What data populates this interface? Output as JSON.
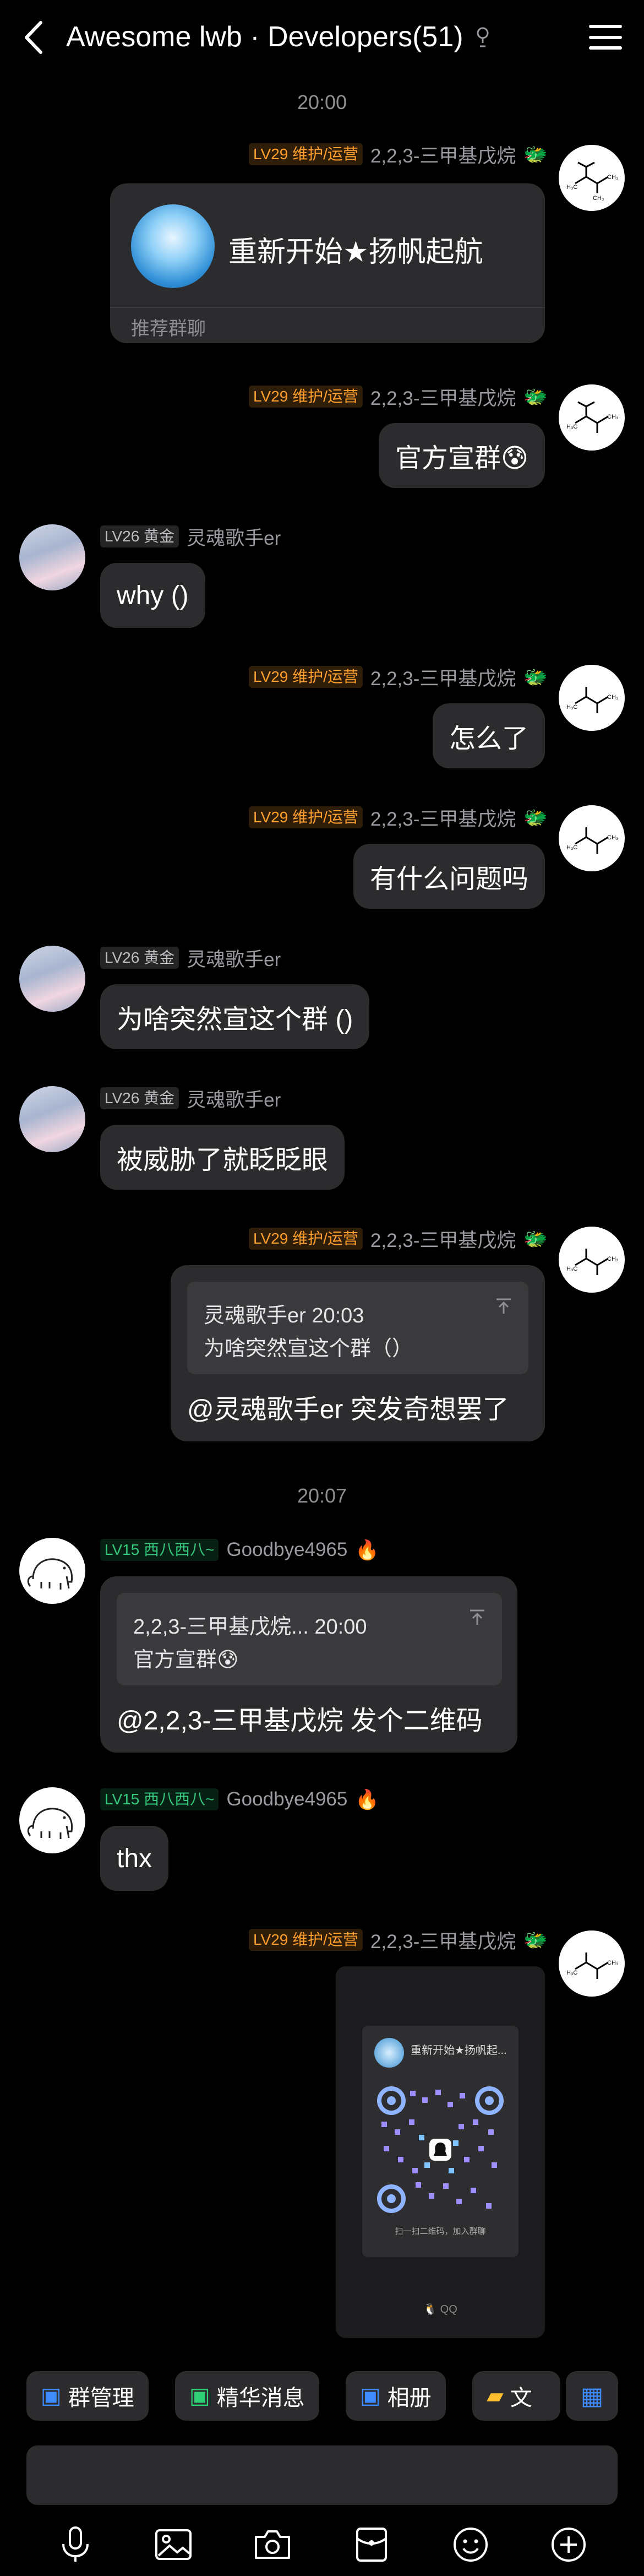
{
  "header": {
    "title": "Awesome lwb · Developers(51)",
    "back_icon": "chevron-left-icon",
    "robot_icon": "robot-icon",
    "menu_icon": "hamburger-menu-icon"
  },
  "timestamps": [
    "20:00",
    "20:07"
  ],
  "messages": [
    {
      "sender": "2,2,3-三甲基戊烷",
      "badge": "LV29 维护/运营",
      "type": "group-card",
      "card_title": "重新开始★扬帆起航",
      "card_footer": "推荐群聊"
    },
    {
      "sender": "2,2,3-三甲基戊烷",
      "badge": "LV29 维护/运营",
      "text": "官方宣群😰"
    },
    {
      "sender": "灵魂歌手er",
      "badge": "LV26 黄金",
      "text": "why ()"
    },
    {
      "sender": "2,2,3-三甲基戊烷",
      "badge": "LV29 维护/运营",
      "text": "怎么了"
    },
    {
      "sender": "2,2,3-三甲基戊烷",
      "badge": "LV29 维护/运营",
      "text": "有什么问题吗"
    },
    {
      "sender": "灵魂歌手er",
      "badge": "LV26 黄金",
      "text": "为啥突然宣这个群 ()"
    },
    {
      "sender": "灵魂歌手er",
      "badge": "LV26 黄金",
      "text": "被威胁了就眨眨眼"
    },
    {
      "sender": "2,2,3-三甲基戊烷",
      "badge": "LV29 维护/运营",
      "quote_header": "灵魂歌手er 20:03",
      "quote_text": "为啥突然宣这个群（）",
      "text": "@灵魂歌手er 突发奇想罢了"
    },
    {
      "sender": "Goodbye4965",
      "badge": "LV15 西八西八~",
      "quote_header": "2,2,3-三甲基戊烷... 20:00",
      "quote_text": "官方宣群😰",
      "text": "@2,2,3-三甲基戊烷 发个二维码"
    },
    {
      "sender": "Goodbye4965",
      "badge": "LV15 西八西八~",
      "text": "thx"
    },
    {
      "sender": "2,2,3-三甲基戊烷",
      "badge": "LV29 维护/运营",
      "type": "image",
      "image_title": "重新开始★扬帆起...",
      "image_caption": "扫一扫二维码，加入群聊",
      "image_logo": "QQ"
    }
  ],
  "toolbar": {
    "chips": [
      {
        "label": "群管理",
        "icon": "group-manage-icon"
      },
      {
        "label": "精华消息",
        "icon": "highlight-message-icon"
      },
      {
        "label": "相册",
        "icon": "album-icon"
      },
      {
        "label": "文",
        "icon": "folder-icon"
      }
    ],
    "extra_icon": "apps-grid-icon"
  },
  "input": {
    "value": ""
  },
  "bottom_icons": [
    "microphone-icon",
    "image-icon",
    "camera-icon",
    "red-packet-icon",
    "emoji-icon",
    "plus-icon"
  ],
  "colors": {
    "admin_badge": "#ff9f2e",
    "member_badge": "#bdbdc2",
    "green_badge": "#34c77b",
    "bubble": "#2c2c2e"
  }
}
